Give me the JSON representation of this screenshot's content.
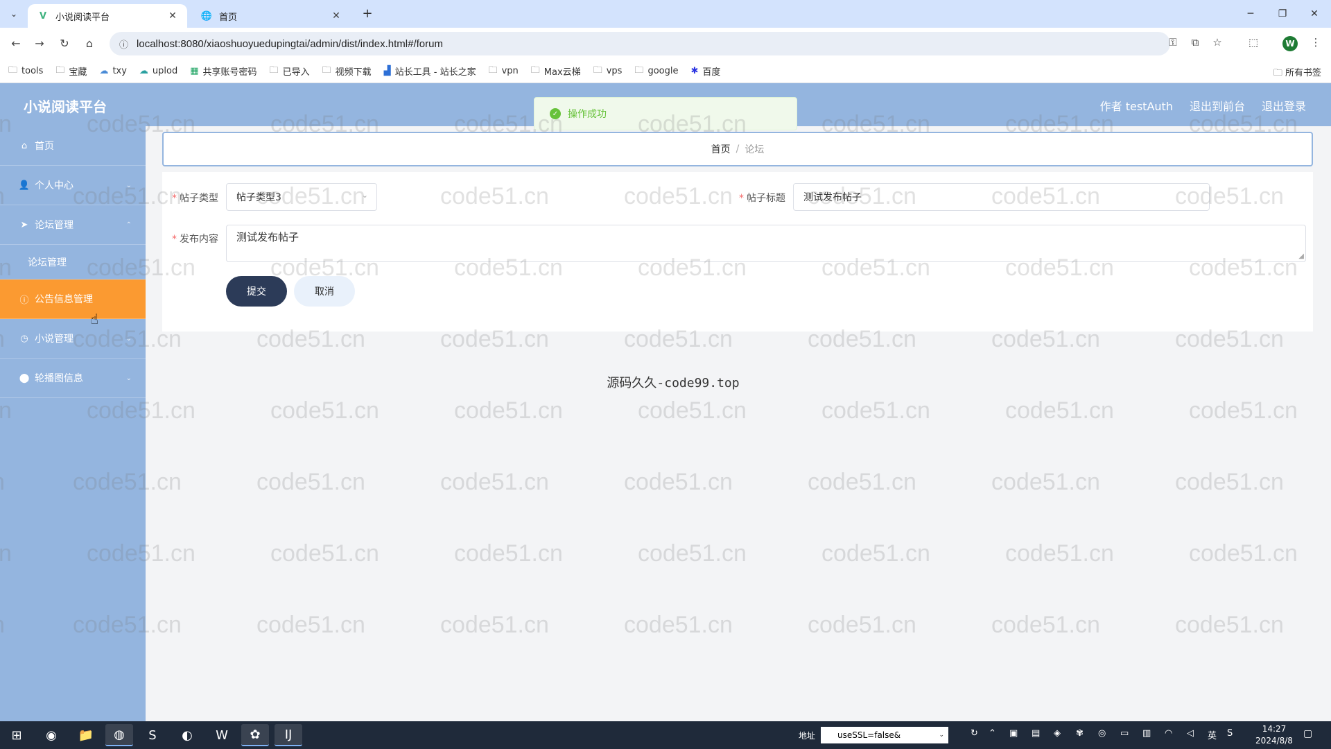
{
  "browser": {
    "tabs": [
      {
        "title": "小说阅读平台",
        "favicon": "vue-logo-icon",
        "active": true
      },
      {
        "title": "首页",
        "favicon": "globe-icon",
        "active": false
      }
    ],
    "url": "localhost:8080/xiaoshuoyuedupingtai/admin/dist/index.html#/forum",
    "profile_initial": "W",
    "bookmarks": [
      "tools",
      "宝藏",
      "txy",
      "uplod",
      "共享账号密码",
      "已导入",
      "视频下载",
      "站长工具 - 站长之家",
      "vpn",
      "Max云梯",
      "vps",
      "google",
      "百度"
    ],
    "bookmarks_all": "所有书签"
  },
  "app": {
    "title": "小说阅读平台",
    "header_links": {
      "user": "作者 testAuth",
      "front": "退出到前台",
      "logout": "退出登录"
    }
  },
  "sidebar": {
    "items": [
      {
        "label": "首页",
        "icon": "home-icon"
      },
      {
        "label": "个人中心",
        "icon": "user-icon"
      },
      {
        "label": "论坛管理",
        "icon": "send-icon"
      },
      {
        "label": "论坛管理",
        "sub": true
      },
      {
        "label": "公告信息管理",
        "icon": "info-icon",
        "active": true
      },
      {
        "label": "小说管理",
        "icon": "clock-icon"
      },
      {
        "label": "轮播图信息",
        "icon": "location-icon"
      }
    ]
  },
  "breadcrumb": {
    "home": "首页",
    "separator": "/",
    "current": "论坛"
  },
  "form": {
    "type_label": "帖子类型",
    "type_value": "帖子类型3",
    "title_label": "帖子标题",
    "title_value": "测试发布帖子",
    "content_label": "发布内容",
    "content_value": "测试发布帖子",
    "submit_label": "提交",
    "cancel_label": "取消"
  },
  "toast": {
    "message": "操作成功"
  },
  "footer": {
    "text": "源码久久-code99.top"
  },
  "watermark": {
    "text": "code51.cn"
  },
  "taskbar": {
    "addr_label": "地址",
    "addr_value": "useSSL=false&",
    "ime": "英",
    "time": "14:27",
    "date": "2024/8/8"
  }
}
